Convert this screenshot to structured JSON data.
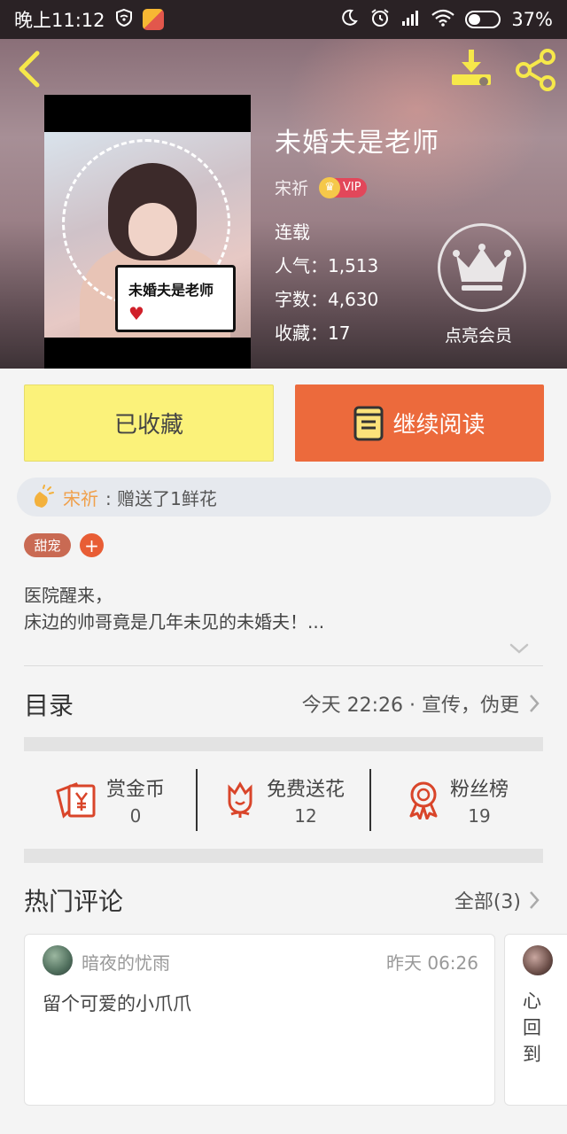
{
  "status_bar": {
    "time": "晚上11:12",
    "battery": "37%",
    "icons": [
      "shield-wifi-icon",
      "app-badge-icon",
      "moon-icon",
      "alarm-icon",
      "signal-icon",
      "wifi-icon",
      "battery-icon"
    ]
  },
  "book": {
    "title": "未婚夫是老师",
    "author": "宋祈",
    "vip_label": "VIP",
    "status": "连载",
    "popularity": "人气：1,513",
    "words": "字数：4,630",
    "favorites": "收藏：17",
    "cover_caption": "未婚夫是老师",
    "cover_heart": "♥"
  },
  "member": {
    "label": "点亮会员"
  },
  "actions": {
    "favorite_label": "已收藏",
    "read_label": "继续阅读"
  },
  "gift": {
    "user": "宋祈",
    "message": ": 赠送了1鲜花"
  },
  "tags": {
    "items": [
      "甜宠"
    ],
    "add": "+"
  },
  "intro": {
    "line1": "医院醒来，",
    "line2": "床边的帅哥竟是几年未见的未婚夫！..."
  },
  "catalog": {
    "title": "目录",
    "latest": "今天 22:26 · 宣传，伪更"
  },
  "stats": [
    {
      "label": "赏金币",
      "value": "0",
      "icon": "red-envelope-icon"
    },
    {
      "label": "免费送花",
      "value": "12",
      "icon": "flower-icon"
    },
    {
      "label": "粉丝榜",
      "value": "19",
      "icon": "medal-icon"
    }
  ],
  "comments": {
    "title": "热门评论",
    "all_label": "全部(3)",
    "items": [
      {
        "user": "暗夜的忧雨",
        "time": "昨天 06:26",
        "text": "留个可爱的小爪爪"
      },
      {
        "text": "心回到"
      }
    ]
  },
  "colors": {
    "accent_orange": "#ec6a3c",
    "favorite_yellow": "#fbf27a",
    "tag_red": "#c96a53",
    "gift_name": "#f0a04b",
    "stat_icon_red": "#d9452a"
  }
}
